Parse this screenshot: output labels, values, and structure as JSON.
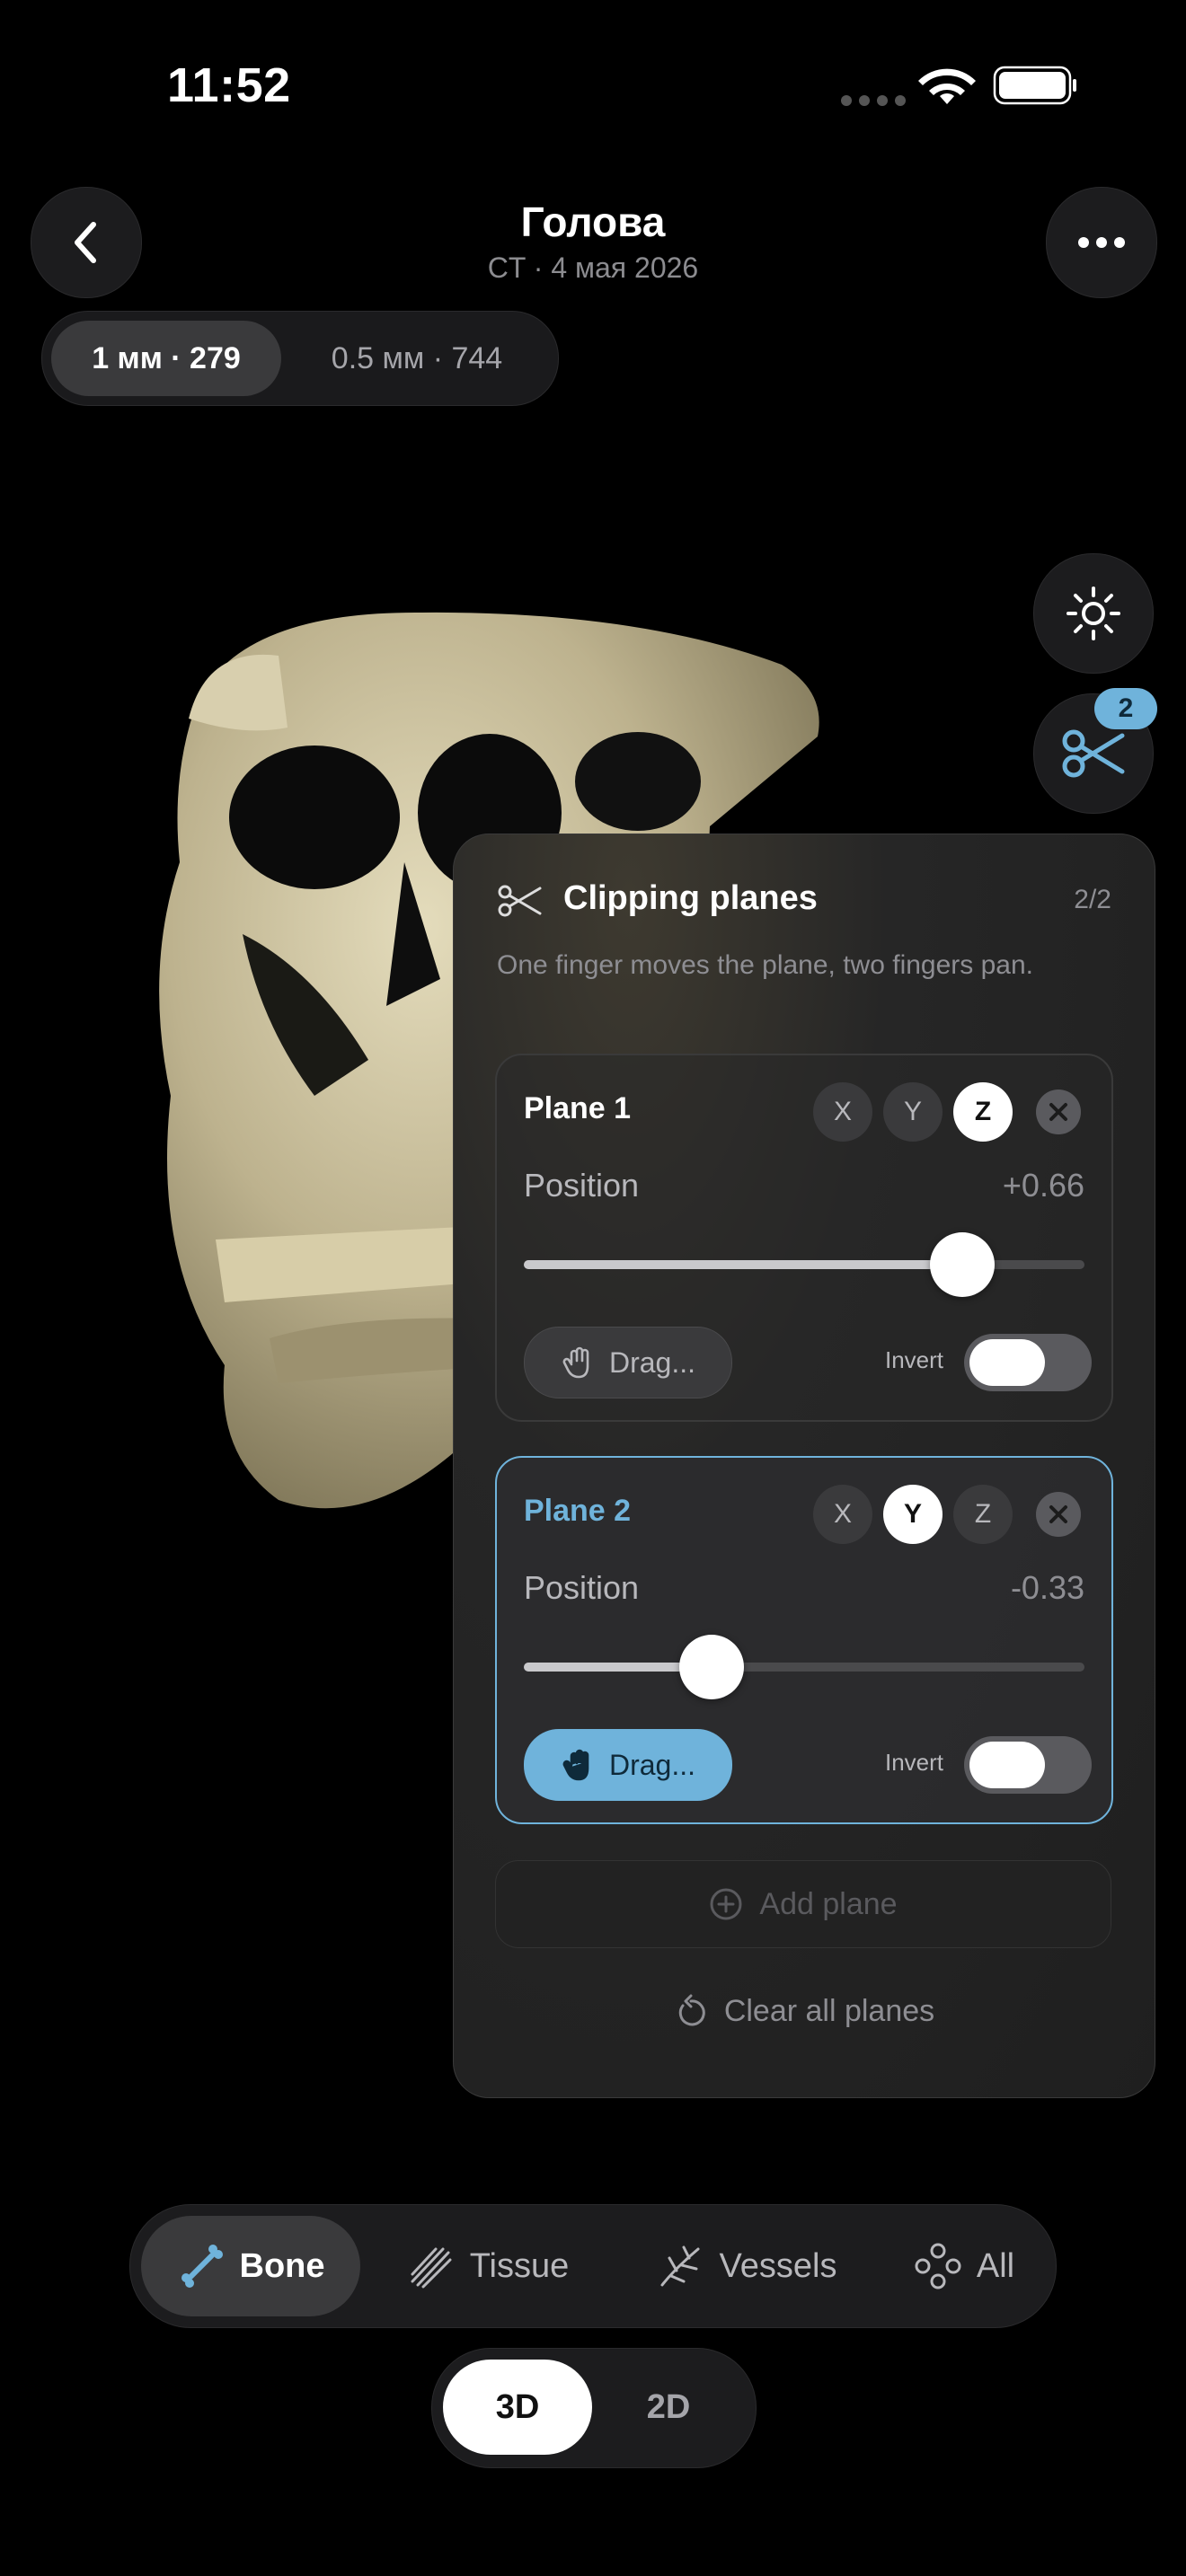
{
  "status_bar": {
    "time": "11:52"
  },
  "header": {
    "title": "Голова",
    "subtitle": "CT · 4 мая 2026"
  },
  "resolution": {
    "options": [
      "1 мм · 279",
      "0.5 мм · 744"
    ],
    "selected": "1 мм · 279"
  },
  "side_buttons": {
    "clip_badge": "2"
  },
  "clipping_panel": {
    "title": "Clipping planes",
    "count": "2/2",
    "hint": "One finger moves the plane, two fingers pan.",
    "planes": [
      {
        "name": "Plane 1",
        "axes": [
          "X",
          "Y",
          "Z"
        ],
        "selected_axis": "Z",
        "position_label": "Position",
        "position_value": "+0.66",
        "slider_fraction": 0.83,
        "drag_label": "Drag...",
        "drag_active": false,
        "invert_label": "Invert",
        "invert_on": false,
        "active": false
      },
      {
        "name": "Plane 2",
        "axes": [
          "X",
          "Y",
          "Z"
        ],
        "selected_axis": "Y",
        "position_label": "Position",
        "position_value": "-0.33",
        "slider_fraction": 0.335,
        "drag_label": "Drag...",
        "drag_active": true,
        "invert_label": "Invert",
        "invert_on": false,
        "active": true
      }
    ],
    "add_plane_label": "Add plane",
    "clear_all_label": "Clear all planes"
  },
  "tissue_selector": {
    "options": [
      "Bone",
      "Tissue",
      "Vessels",
      "All"
    ],
    "selected": "Bone"
  },
  "view_mode": {
    "options": [
      "3D",
      "2D"
    ],
    "selected": "3D"
  },
  "colors": {
    "accent": "#6fb3db",
    "bone": "#c9c0a0",
    "background": "#000000"
  }
}
